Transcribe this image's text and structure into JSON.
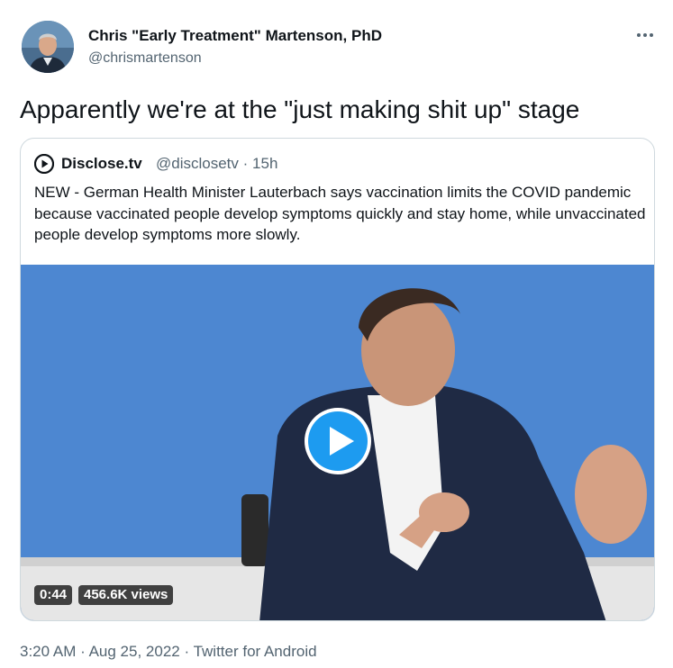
{
  "tweet": {
    "author_name": "Chris \"Early Treatment\" Martenson, PhD",
    "author_handle": "@chrismartenson",
    "text": "Apparently we're at the \"just making shit up\" stage",
    "time": "3:20 AM",
    "date": "Aug 25, 2022",
    "source": "Twitter for Android",
    "separator": "·",
    "more_icon": "more-horizontal-icon"
  },
  "quote": {
    "name": "Disclose.tv",
    "handle": "@disclosetv",
    "separator": "·",
    "age": "15h",
    "logo_icon": "play-circle-logo-icon",
    "text": "NEW - German Health Minister Lauterbach says vaccination limits the COVID pandemic because vaccinated people develop symptoms quickly and stay home, while unvaccinated people develop symptoms more slowly."
  },
  "video": {
    "duration": "0:44",
    "views": "456.6K views",
    "play_icon": "play-icon"
  },
  "colors": {
    "text": "#0f1419",
    "secondary": "#536471",
    "border": "#cfd9de",
    "play_blue": "#1d9bf0",
    "video_bg": "#4d87d1"
  }
}
